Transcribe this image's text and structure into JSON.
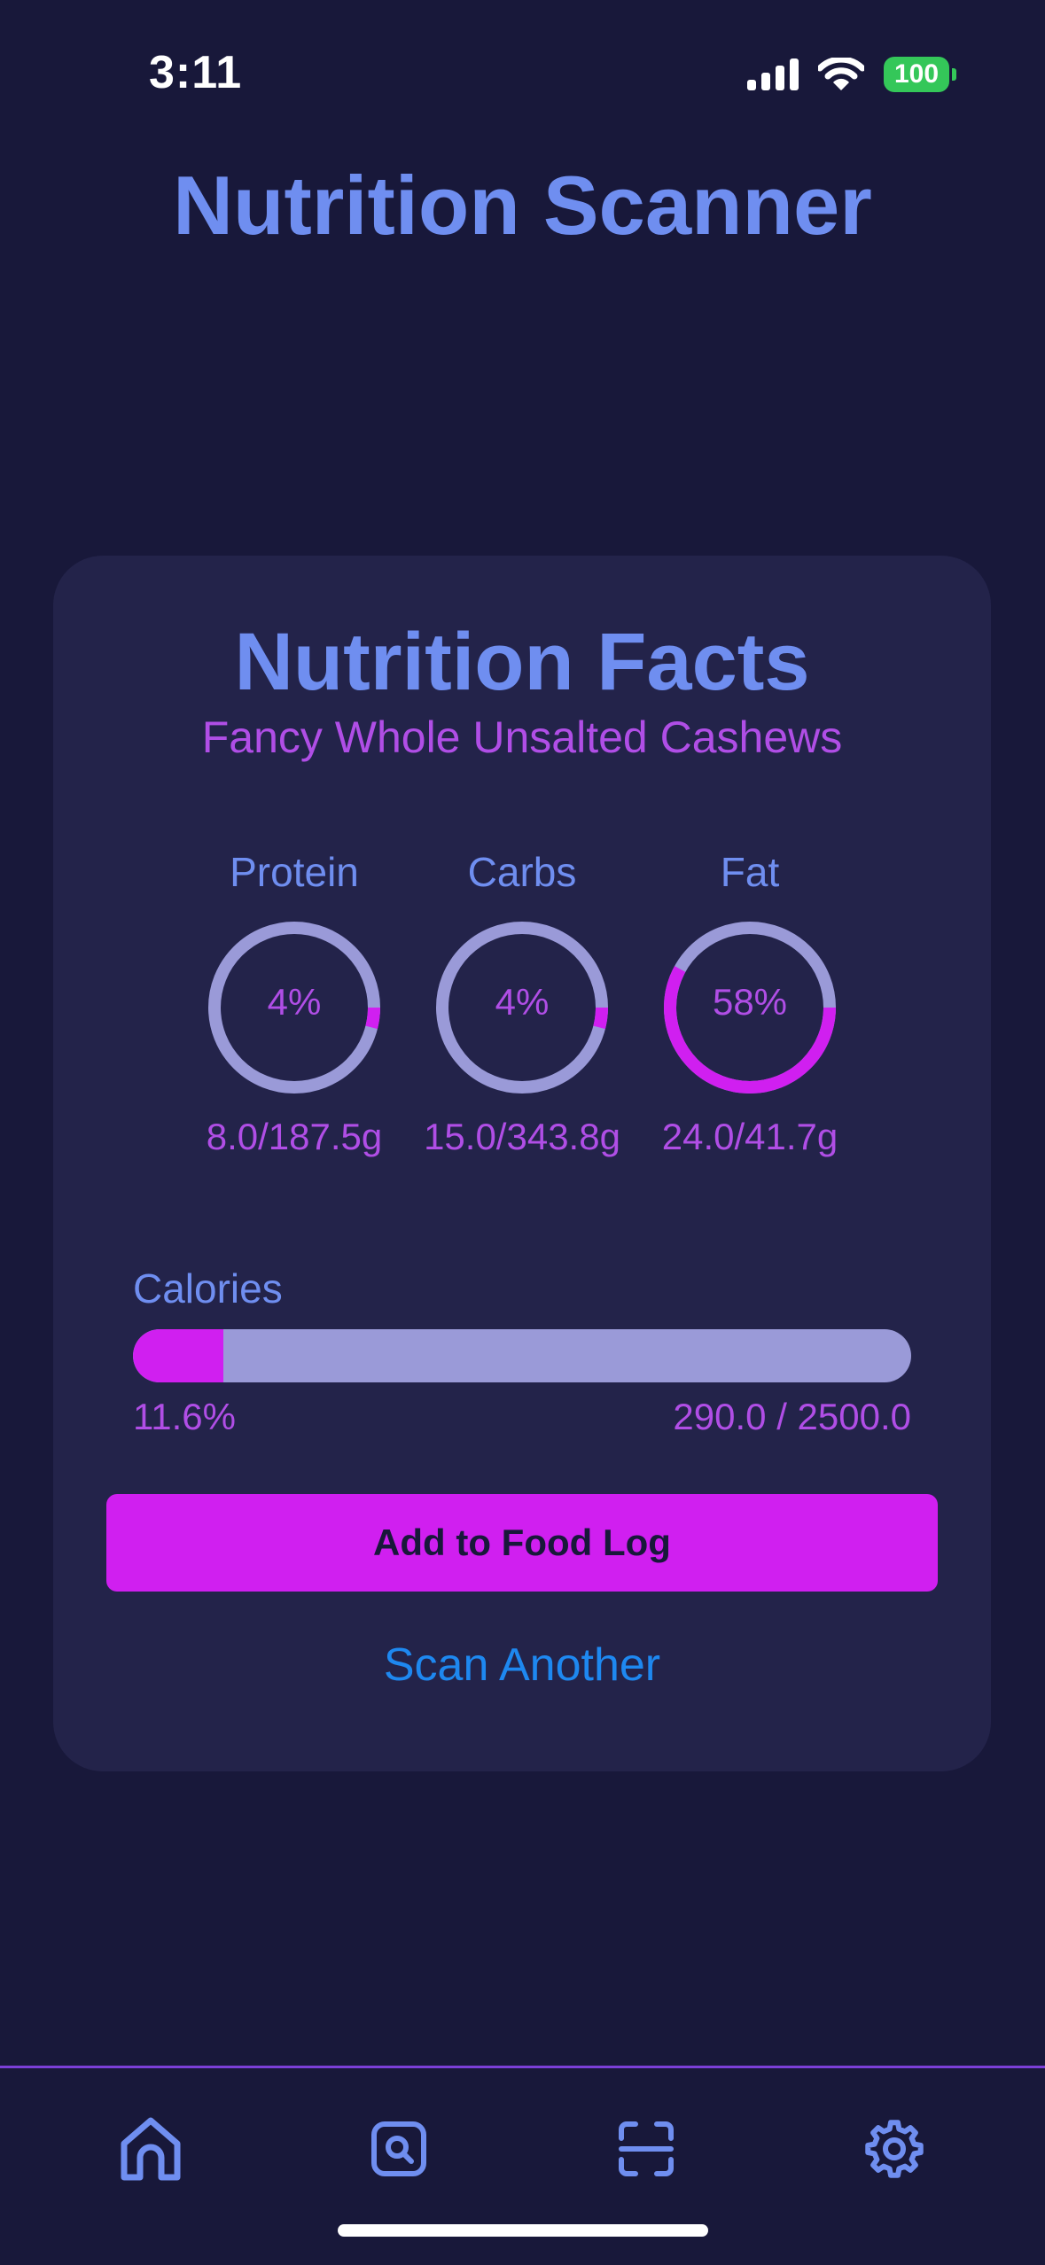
{
  "status_bar": {
    "time": "3:11",
    "battery": "100"
  },
  "app_title": "Nutrition Scanner",
  "card": {
    "title": "Nutrition Facts",
    "product": "Fancy Whole Unsalted Cashews",
    "macros": [
      {
        "label": "Protein",
        "percent_text": "4%",
        "fraction": 0.04,
        "amount": "8.0/187.5g"
      },
      {
        "label": "Carbs",
        "percent_text": "4%",
        "fraction": 0.04,
        "amount": "15.0/343.8g"
      },
      {
        "label": "Fat",
        "percent_text": "58%",
        "fraction": 0.58,
        "amount": "24.0/41.7g"
      }
    ],
    "calories": {
      "label": "Calories",
      "percent_text": "11.6%",
      "fraction": 0.116,
      "total": "290.0 / 2500.0"
    },
    "add_button": "Add to Food Log",
    "scan_another": "Scan Another"
  },
  "tabs": [
    {
      "icon": "home-icon"
    },
    {
      "icon": "search-icon"
    },
    {
      "icon": "scan-icon"
    },
    {
      "icon": "gear-icon"
    }
  ],
  "colors": {
    "background": "#18183a",
    "card": "#23234a",
    "title_blue": "#6f8ef0",
    "accent_magenta": "#d01ff0",
    "ring_track": "#9a9ad8",
    "link_blue": "#1e88f0",
    "battery_green": "#34c759"
  }
}
